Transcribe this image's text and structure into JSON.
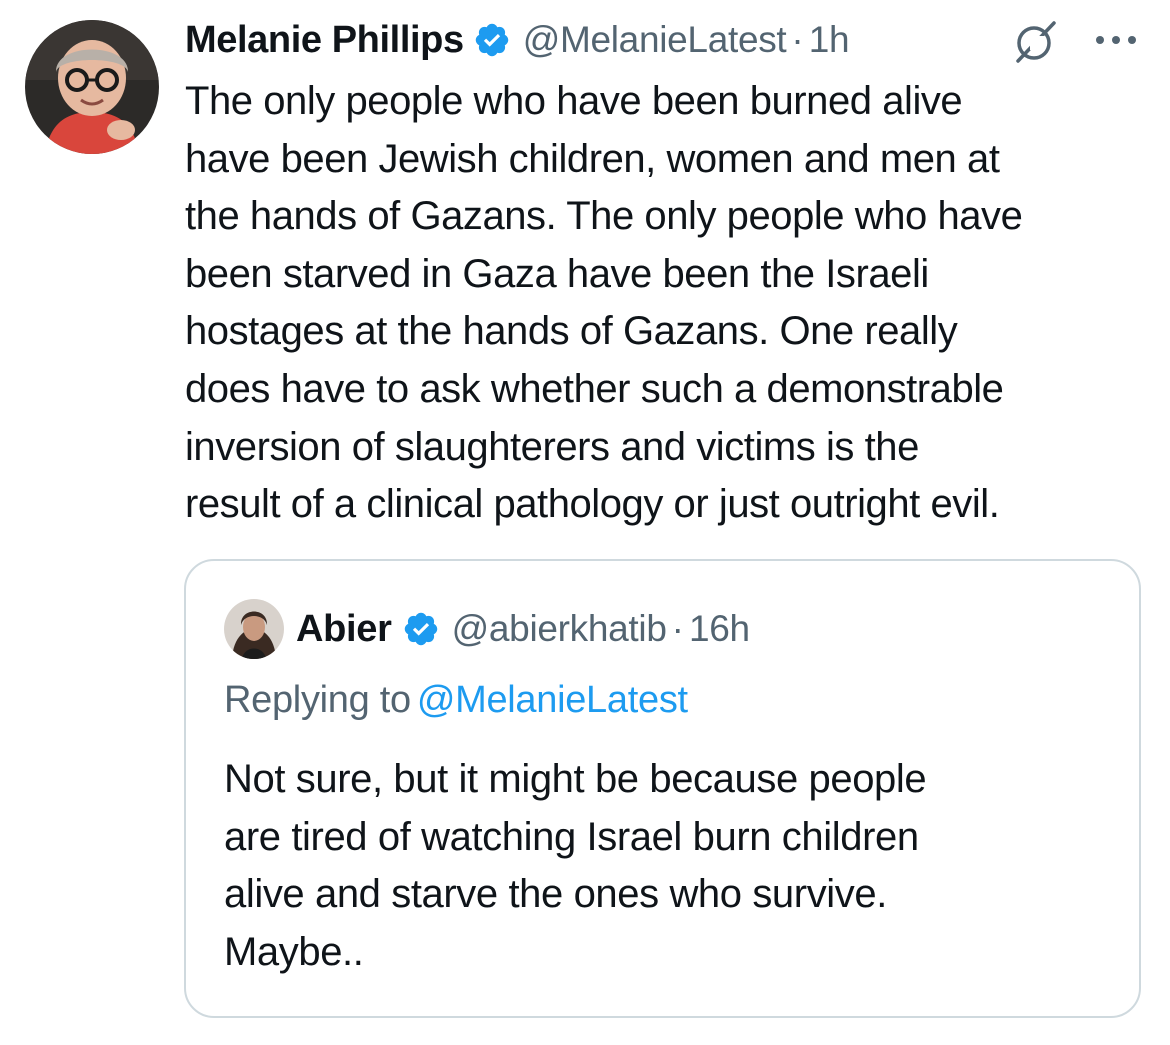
{
  "tweet": {
    "author": {
      "display_name": "Melanie Phillips",
      "handle": "@MelanieLatest",
      "verified": true
    },
    "separator": "·",
    "time": "1h",
    "text_lines": [
      "The only people who have been burned alive",
      "have been Jewish children, women and men at",
      "the hands of Gazans. The only people who have",
      "been starved in Gaza have been the Israeli",
      "hostages at the hands of Gazans. One really",
      "does have to ask whether such a demonstrable",
      "inversion of slaughterers and victims is the",
      "result of a clinical pathology or just outright evil."
    ],
    "icons": {
      "grok": "grok-icon",
      "more": "more-icon",
      "verified": "verified-badge-icon"
    }
  },
  "quoted_tweet": {
    "author": {
      "display_name": "Abier",
      "handle": "@abierkhatib",
      "verified": true
    },
    "separator": "·",
    "time": "16h",
    "replying_label": "Replying to",
    "replying_to": "@MelanieLatest",
    "text_lines": [
      "Not sure, but it might be because people",
      "are tired of watching Israel burn children",
      "alive and starve the ones who survive.",
      "Maybe.."
    ]
  },
  "colors": {
    "text": "#0f1419",
    "secondary": "#536471",
    "accent": "#1d9bf0",
    "border": "#cfd9de"
  }
}
